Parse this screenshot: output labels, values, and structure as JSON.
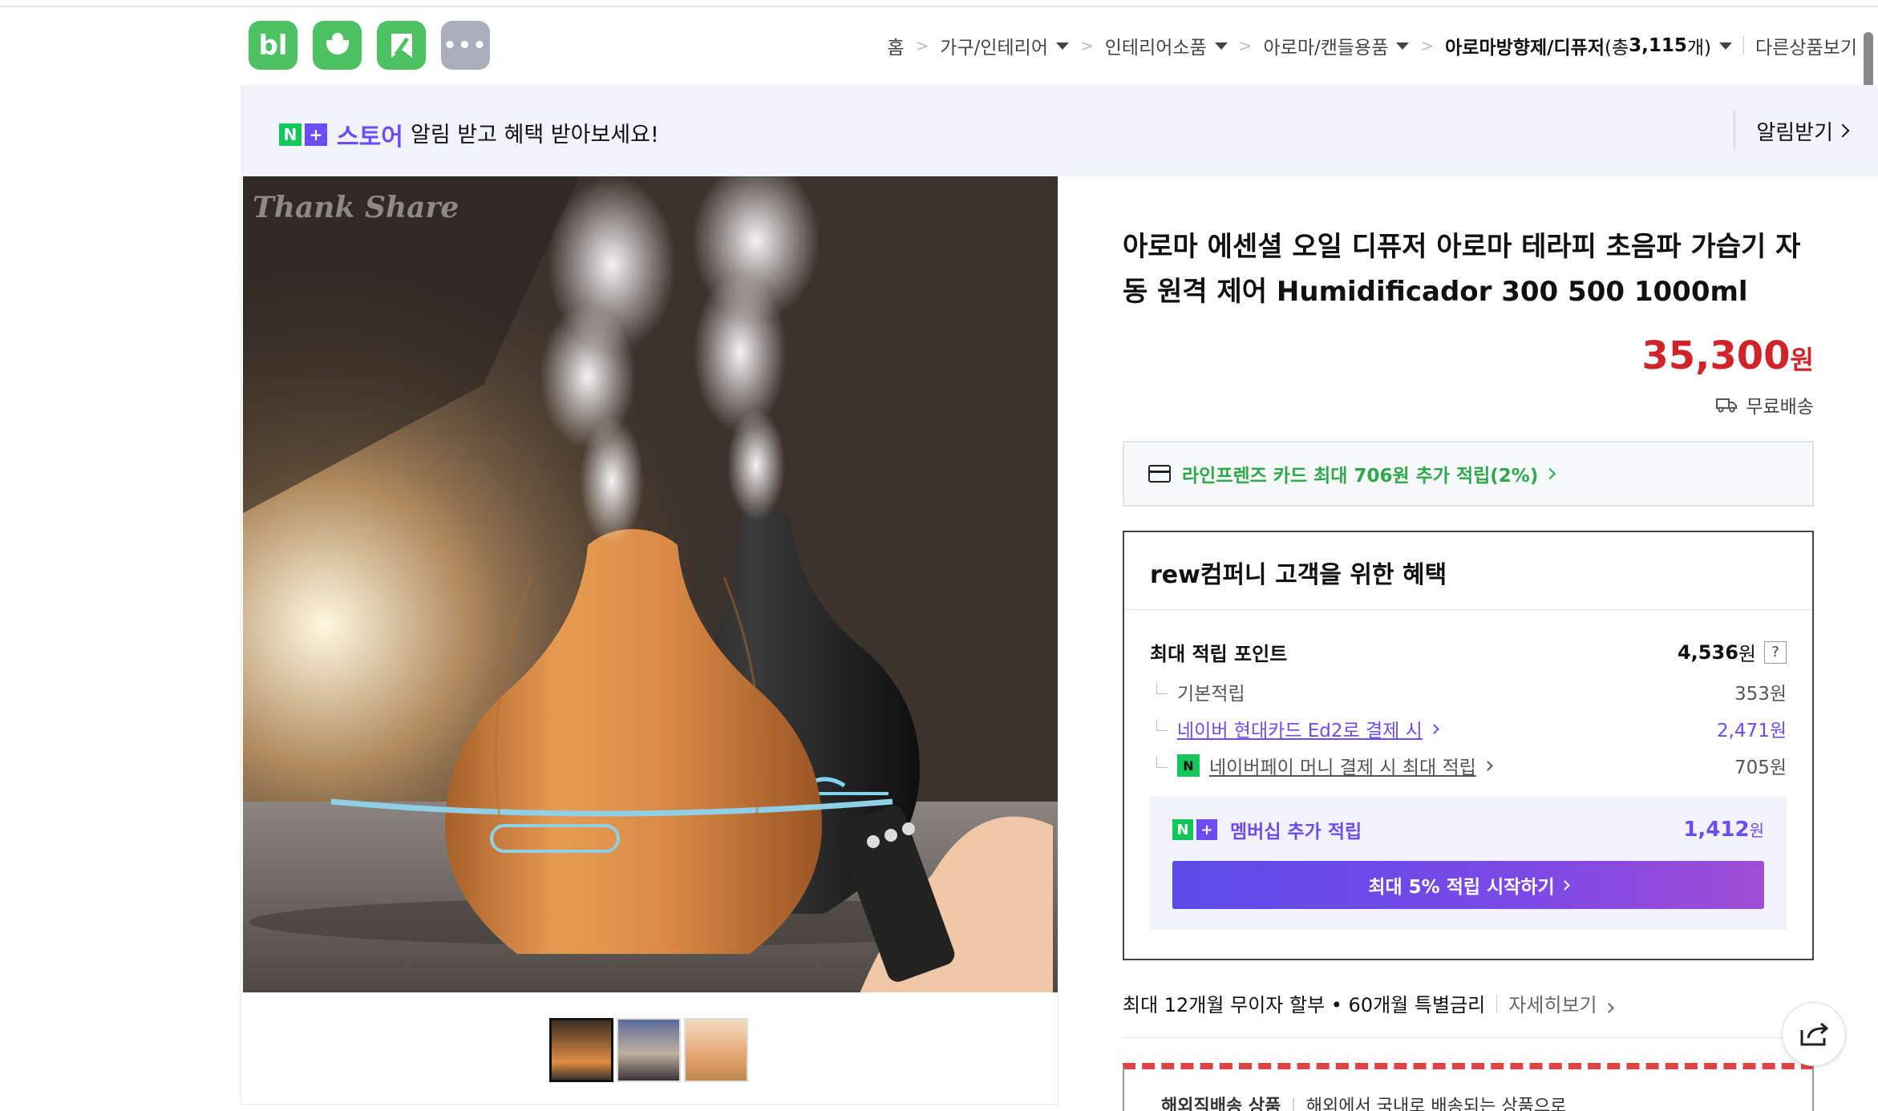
{
  "header": {
    "app_icons": [
      {
        "name": "blog-icon",
        "label": "bl"
      },
      {
        "name": "cafe-icon",
        "label": ""
      },
      {
        "name": "bookmark-icon",
        "label": ""
      },
      {
        "name": "more-icon",
        "label": "•••"
      }
    ],
    "breadcrumb": {
      "home": "홈",
      "level1": "가구/인테리어",
      "level2": "인테리어소품",
      "level3": "아로마/캔들용품",
      "current": "아로마방향제/디퓨저",
      "count_prefix": "(총 ",
      "count": "3,115",
      "count_suffix": "개)",
      "other": "다른상품보기"
    }
  },
  "banner": {
    "n_label": "N",
    "plus_label": "+",
    "store_label": "스토어",
    "text": "알림 받고 혜택 받아보세요!",
    "action": "알림받기"
  },
  "product": {
    "watermark": "Thank Share",
    "title": "아로마 에센셜 오일 디퓨저 아로마 테라피 초음파 가습기 자동 원격 제어 Humidificador 300 500 1000ml",
    "price": "35,300",
    "price_unit": "원",
    "shipping": "무료배송",
    "card_benefit": "라인프렌즈 카드 최대 706원 추가 적립(2%)"
  },
  "benefits": {
    "title": "rew컴퍼니 고객을 위한 혜택",
    "max_points_label": "최대 적립 포인트",
    "max_points_value": "4,536",
    "max_points_unit": "원",
    "help": "?",
    "basic_label": "기본적립",
    "basic_value": "353원",
    "hyundai_label": "네이버 현대카드 Ed2로 결제 시",
    "hyundai_value": "2,471원",
    "npay_label": "네이버페이 머니 결제 시 최대 적립",
    "npay_value": "705원",
    "member_label": "멤버십 추가 적립",
    "member_value": "1,412",
    "member_unit": "원",
    "member_button": "최대 5% 적립 시작하기"
  },
  "installment": {
    "text": "최대 12개월 무이자 할부 • 60개월 특별금리",
    "more": "자세히보기"
  },
  "overseas": {
    "title": "해외직배송 상품",
    "text": "해외에서 국내로 배송되는 상품으로"
  },
  "colors": {
    "brand_green": "#4ec162",
    "naver_purple": "#6d4cf3",
    "price_red": "#d0232a",
    "benefit_green": "#2ea84a"
  }
}
